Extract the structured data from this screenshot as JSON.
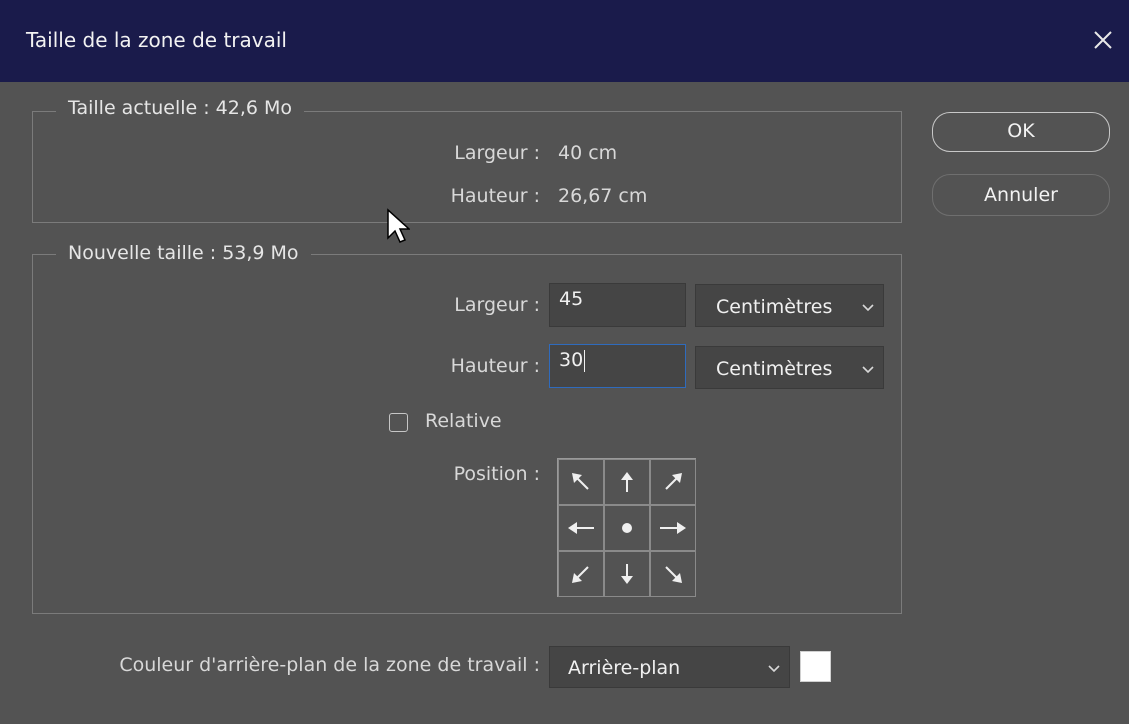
{
  "window": {
    "title": "Taille de la zone de travail",
    "close_icon": "close-icon"
  },
  "current_size": {
    "legend": "Taille actuelle : 42,6 Mo",
    "width_label": "Largeur :",
    "width_value": "40 cm",
    "height_label": "Hauteur :",
    "height_value": "26,67 cm"
  },
  "new_size": {
    "legend": "Nouvelle taille : 53,9 Mo",
    "width_label": "Largeur :",
    "width_value": "45",
    "width_unit": "Centimètres",
    "height_label": "Hauteur :",
    "height_value": "30",
    "height_unit": "Centimètres",
    "relative_label": "Relative",
    "relative_checked": false,
    "position_label": "Position :",
    "anchor_icons": [
      "arrow-up-left-icon",
      "arrow-up-icon",
      "arrow-up-right-icon",
      "arrow-left-icon",
      "center-dot-icon",
      "arrow-right-icon",
      "arrow-down-left-icon",
      "arrow-down-icon",
      "arrow-down-right-icon"
    ]
  },
  "background": {
    "label": "Couleur d'arrière-plan de la zone de travail :",
    "value": "Arrière-plan",
    "swatch_color": "#ffffff"
  },
  "buttons": {
    "ok": "OK",
    "cancel": "Annuler"
  },
  "colors": {
    "titlebar": "#1a1b4b",
    "dialog_bg": "#535353",
    "focus_border": "#2f6bbd"
  }
}
